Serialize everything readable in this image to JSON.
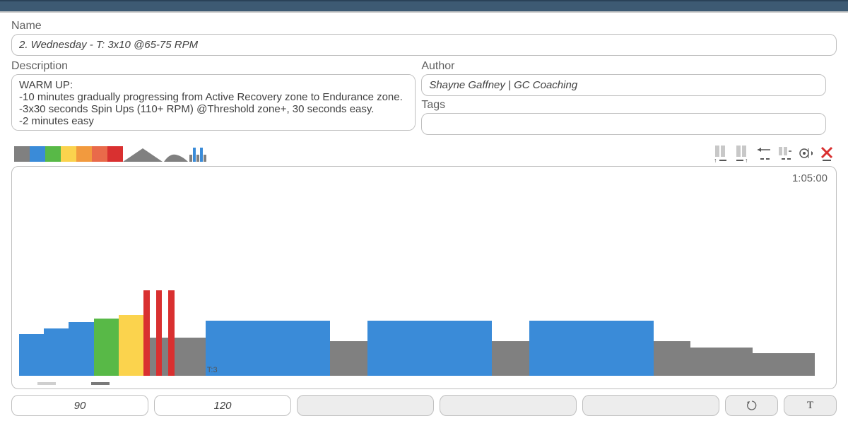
{
  "labels": {
    "name": "Name",
    "description": "Description",
    "author": "Author",
    "tags": "Tags"
  },
  "fields": {
    "name": "2. Wednesday - T: 3x10 @65-75 RPM",
    "description": "WARM UP:\n-10 minutes gradually progressing from Active Recovery zone to Endurance zone.\n-3x30 seconds Spin Ups (110+ RPM) @Threshold zone+, 30 seconds easy.\n-2 minutes easy",
    "author": "Shayne Gaffney | GC Coaching",
    "tags": ""
  },
  "palette": {
    "colors": [
      "#808080",
      "#3a8bd8",
      "#58b947",
      "#fbd34d",
      "#f29a3e",
      "#e96a4a",
      "#d93030"
    ]
  },
  "tools": {
    "move_left": "move-left",
    "move_right": "move-right",
    "stretch": "stretch",
    "skip": "skip",
    "repeat": "repeat",
    "delete": "delete"
  },
  "chart_data": {
    "type": "bar",
    "total_duration_label": "1:05:00",
    "total_duration_min": 65,
    "segment_label": "T:3",
    "segments": [
      {
        "duration_min": 2.0,
        "height_pct": 22,
        "color": "#3a8bd8"
      },
      {
        "duration_min": 2.0,
        "height_pct": 25,
        "color": "#3a8bd8"
      },
      {
        "duration_min": 2.0,
        "height_pct": 28,
        "color": "#3a8bd8"
      },
      {
        "duration_min": 2.0,
        "height_pct": 30,
        "color": "#58b947"
      },
      {
        "duration_min": 2.0,
        "height_pct": 32,
        "color": "#fbd34d"
      },
      {
        "duration_min": 0.5,
        "height_pct": 45,
        "color": "#d93030"
      },
      {
        "duration_min": 0.5,
        "height_pct": 20,
        "color": "#808080"
      },
      {
        "duration_min": 0.5,
        "height_pct": 45,
        "color": "#d93030"
      },
      {
        "duration_min": 0.5,
        "height_pct": 20,
        "color": "#808080"
      },
      {
        "duration_min": 0.5,
        "height_pct": 45,
        "color": "#d93030"
      },
      {
        "duration_min": 0.5,
        "height_pct": 20,
        "color": "#808080"
      },
      {
        "duration_min": 2.0,
        "height_pct": 20,
        "color": "#808080"
      },
      {
        "duration_min": 10.0,
        "height_pct": 29,
        "color": "#3a8bd8",
        "label": "T:3"
      },
      {
        "duration_min": 3.0,
        "height_pct": 18,
        "color": "#808080"
      },
      {
        "duration_min": 10.0,
        "height_pct": 29,
        "color": "#3a8bd8"
      },
      {
        "duration_min": 3.0,
        "height_pct": 18,
        "color": "#808080"
      },
      {
        "duration_min": 10.0,
        "height_pct": 29,
        "color": "#3a8bd8"
      },
      {
        "duration_min": 3.0,
        "height_pct": 18,
        "color": "#808080"
      },
      {
        "duration_min": 5.0,
        "height_pct": 15,
        "color": "#808080"
      },
      {
        "duration_min": 5.0,
        "height_pct": 12,
        "color": "#808080"
      }
    ]
  },
  "bottom": {
    "val1": "90",
    "val2": "120",
    "repeat_icon": "↻",
    "text_icon": "T"
  }
}
